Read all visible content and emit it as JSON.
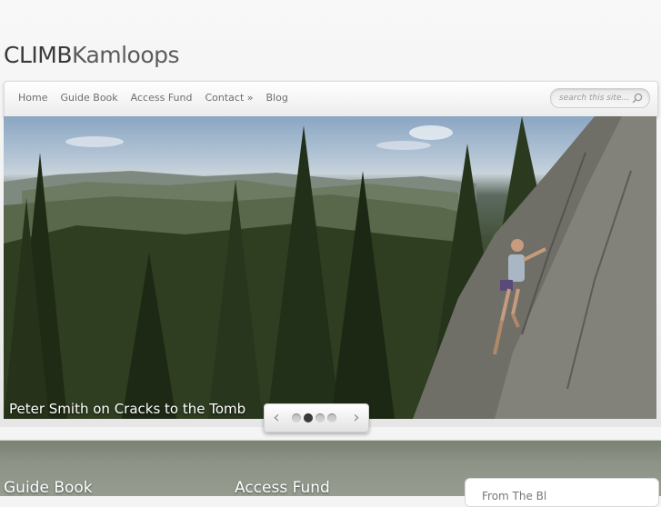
{
  "site": {
    "logo_bold": "CLIMB",
    "logo_light": "Kamloops"
  },
  "nav": {
    "items": [
      {
        "label": "Home"
      },
      {
        "label": "Guide Book"
      },
      {
        "label": "Access Fund"
      },
      {
        "label": "Contact »"
      },
      {
        "label": "Blog"
      }
    ]
  },
  "search": {
    "placeholder": "search this site...",
    "icon": "search-icon"
  },
  "slider": {
    "caption": "Peter Smith on Cracks to the Tomb",
    "prev_label": "‹",
    "next_label": "›",
    "dot_count": 4,
    "active_dot": 2
  },
  "footer": {
    "widget_1_title": "Guide Book",
    "widget_2_title": "Access Fund",
    "widget_3_title": "From The Bl"
  },
  "colors": {
    "accent": "#3b3b3b",
    "footer_bg": "#8d9487"
  }
}
